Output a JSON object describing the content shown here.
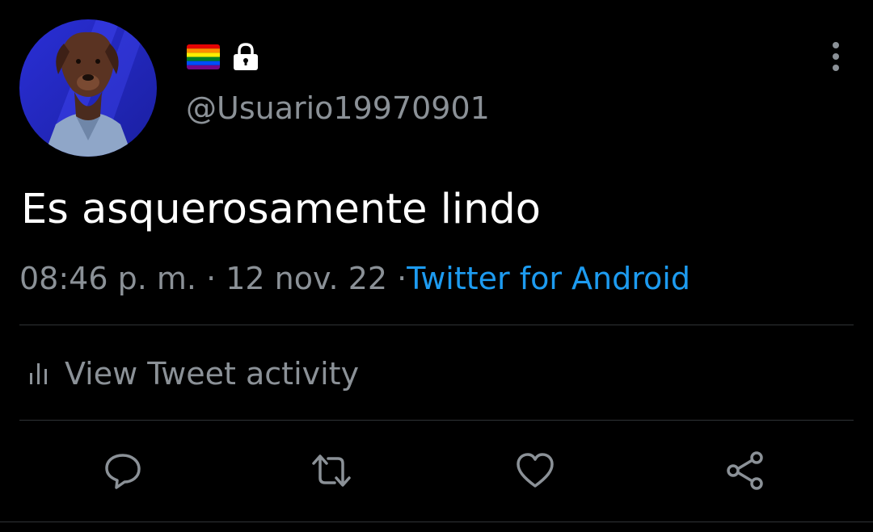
{
  "header": {
    "handle": "@Usuario19970901",
    "icons": [
      "avatar",
      "rainbow-flag-icon",
      "lock-icon",
      "more-vertical-icon"
    ]
  },
  "tweet": {
    "text": "Es asquerosamente lindo",
    "time": "08:46 p. m.",
    "separator": "·",
    "date": "12 nov. 22",
    "source": "Twitter for Android"
  },
  "activity": {
    "label": "View Tweet activity",
    "icon": "bar-chart-icon"
  },
  "actions": {
    "icons": [
      "reply-icon",
      "retweet-icon",
      "like-icon",
      "share-icon"
    ]
  },
  "colors": {
    "background": "#000000",
    "text": "#ffffff",
    "secondary": "#8b9197",
    "link": "#1d9bf0",
    "divider": "#2f3336"
  }
}
